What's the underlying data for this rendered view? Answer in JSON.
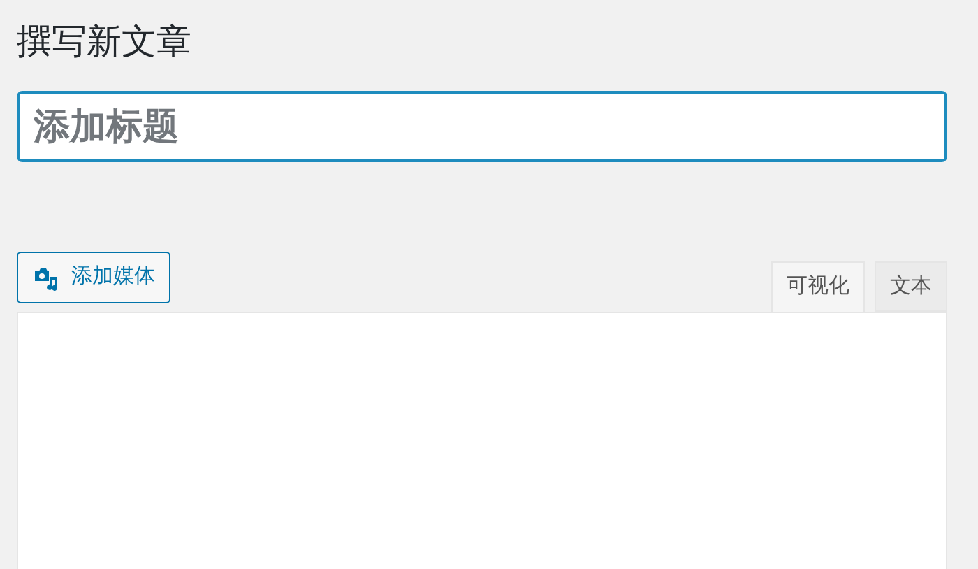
{
  "heading": "撰写新文章",
  "title_field": {
    "placeholder": "添加标题"
  },
  "add_media_button": "添加媒体",
  "editor_tabs": [
    {
      "label": "可视化",
      "selected": true
    },
    {
      "label": "文本",
      "selected": false
    }
  ]
}
